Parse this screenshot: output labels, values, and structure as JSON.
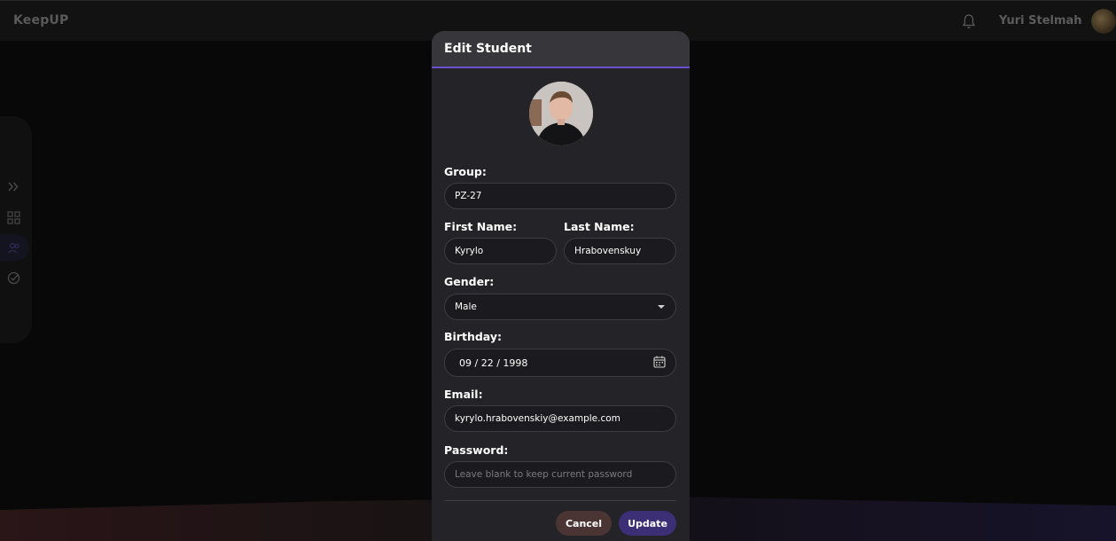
{
  "app": {
    "logo": "KeepUP"
  },
  "header": {
    "username": "Yuri Stelmah"
  },
  "sidebar": {
    "icons": [
      "expand-icon",
      "dashboard-icon",
      "users-icon",
      "check-circle-icon"
    ]
  },
  "modal": {
    "title": "Edit Student",
    "group": {
      "label": "Group:",
      "value": "PZ-27"
    },
    "first_name": {
      "label": "First Name:",
      "value": "Kyrylo"
    },
    "last_name": {
      "label": "Last Name:",
      "value": "Hrabovenskuy"
    },
    "gender": {
      "label": "Gender:",
      "value": "Male"
    },
    "birthday": {
      "label": "Birthday:",
      "value": "09 / 22 / 1998"
    },
    "email": {
      "label": "Email:",
      "value": "kyrylo.hrabovenskiy@example.com"
    },
    "password": {
      "label": "Password:",
      "placeholder": "Leave blank to keep current password"
    },
    "cancel_label": "Cancel",
    "update_label": "Update"
  },
  "colors": {
    "accent": "#6a4fd0",
    "update_button": "#3c2f76",
    "cancel_button": "#4b3534",
    "modal_bg": "#242428"
  }
}
